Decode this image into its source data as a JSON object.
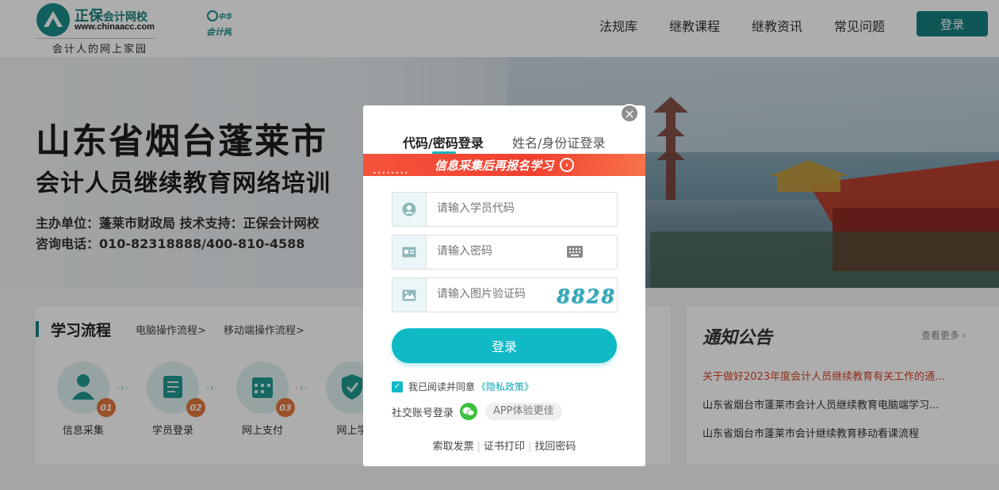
{
  "header": {
    "logo_cn": "正保",
    "logo_cn_small": "会计网校",
    "logo_url": "www.chinaacc.com",
    "logo_tagline": "会计人的网上家园",
    "sub_logo": "中华会计网校",
    "nav": [
      "法规库",
      "继教课程",
      "继教资讯",
      "常见问题"
    ],
    "login_label": "登录"
  },
  "banner": {
    "title_line1": "山东省烟台蓬莱市",
    "title_line2": "会计人员继续教育网络培训",
    "info_line1": "主办单位：蓬莱市财政局  技术支持：正保会计网校",
    "info_line2": "咨询电话：010-82318888/400-810-4588"
  },
  "flow": {
    "title": "学习流程",
    "links": [
      "电脑操作流程>",
      "移动端操作流程>"
    ],
    "steps": [
      {
        "num": "01",
        "label": "信息采集",
        "icon": "person-icon"
      },
      {
        "num": "02",
        "label": "学员登录",
        "icon": "scroll-icon"
      },
      {
        "num": "03",
        "label": "网上支付",
        "icon": "calendar-icon"
      },
      {
        "num": "04",
        "label": "网上学",
        "icon": "shield-icon"
      }
    ]
  },
  "notice": {
    "title": "通知公告",
    "more": "查看更多",
    "items": [
      "关于做好2023年度会计人员继续教育有关工作的通...",
      "山东省烟台市蓬莱市会计人员继续教育电脑端学习...",
      "山东省烟台市蓬莱市会计继续教育移动看课流程"
    ]
  },
  "modal": {
    "close_symbol": "×",
    "tabs": [
      "代码/密码登录",
      "姓名/身份证登录"
    ],
    "promo_text": "信息采集后再报名学习",
    "promo_arrow": "›",
    "fields": {
      "code_placeholder": "请输入学员代码",
      "password_placeholder": "请输入密码",
      "captcha_placeholder": "请输入图片验证码",
      "captcha_value": "8828"
    },
    "submit_label": "登录",
    "agree_text": "我已阅读并同意",
    "privacy_link": "《隐私政策》",
    "social_label": "社交账号登录",
    "app_pill": "APP体验更佳",
    "bottom_links": [
      "索取发票",
      "证书打印",
      "找回密码"
    ]
  },
  "colors": {
    "accent": "#0fb9c6",
    "brand_dark": "#177f80",
    "promo_red": "#f0402f",
    "notice_hot": "#d6462a"
  }
}
